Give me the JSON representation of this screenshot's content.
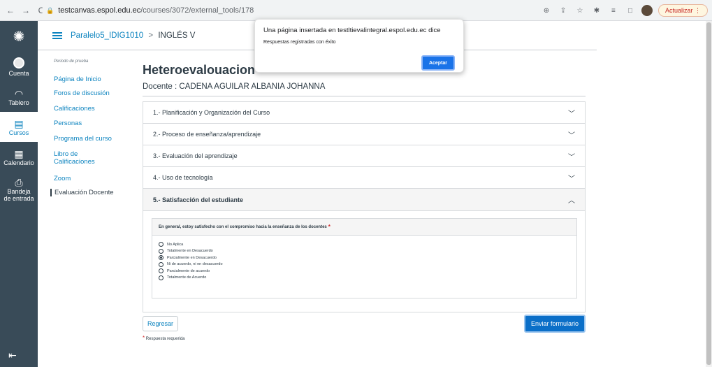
{
  "browser": {
    "url_host": "testcanvas.espol.edu.ec",
    "url_path": "/courses/3072/external_tools/178",
    "update_label": "Actualizar"
  },
  "global_nav": {
    "items": [
      {
        "label": "Cuenta"
      },
      {
        "label": "Tablero"
      },
      {
        "label": "Cursos"
      },
      {
        "label": "Calendario"
      },
      {
        "label": "Bandeja de entrada"
      }
    ]
  },
  "breadcrumb": {
    "course": "Paralelo5_IDIG1010",
    "separator": ">",
    "current": "INGLÉS V"
  },
  "course_nav": {
    "period": "Periodo de prueba",
    "items": [
      "Página de Inicio",
      "Foros de discusión",
      "Calificaciones",
      "Personas",
      "Programa del curso",
      "Libro de Calificaciones",
      "Zoom",
      "Evaluación Docente"
    ]
  },
  "main": {
    "title": "Heteroevalouacion",
    "teacher": "Docente : CADENA AGUILAR ALBANIA JOHANNA",
    "sections": [
      "1.- Planificación y Organización del Curso",
      "2.- Proceso de enseñanza/aprendizaje",
      "3.- Evaluación del aprendizaje",
      "4.- Uso de tecnología",
      "5.- Satisfacción del estudiante"
    ],
    "question": "En general, estoy satisfecho con el compromiso hacia la enseñanza de los docentes",
    "required_mark": "*",
    "options": [
      "No Aplica",
      "Totalmente en Desacuerdo",
      "Parcialmente en Desacuerdo",
      "Ni de acuerdo, ni en desacuerdo",
      "Parcialmente de acuerdo",
      "Totalmente de Acuerdo"
    ],
    "selected_option": "Parcialmente en Desacuerdo",
    "back_label": "Regresar",
    "submit_label": "Enviar formulario",
    "required_note": "Respuesta requerida"
  },
  "dialog": {
    "title": "Una página insertada en testltievalintegral.espol.edu.ec dice",
    "message": "Respuestas registradas con éxito",
    "ok_label": "Aceptar"
  }
}
